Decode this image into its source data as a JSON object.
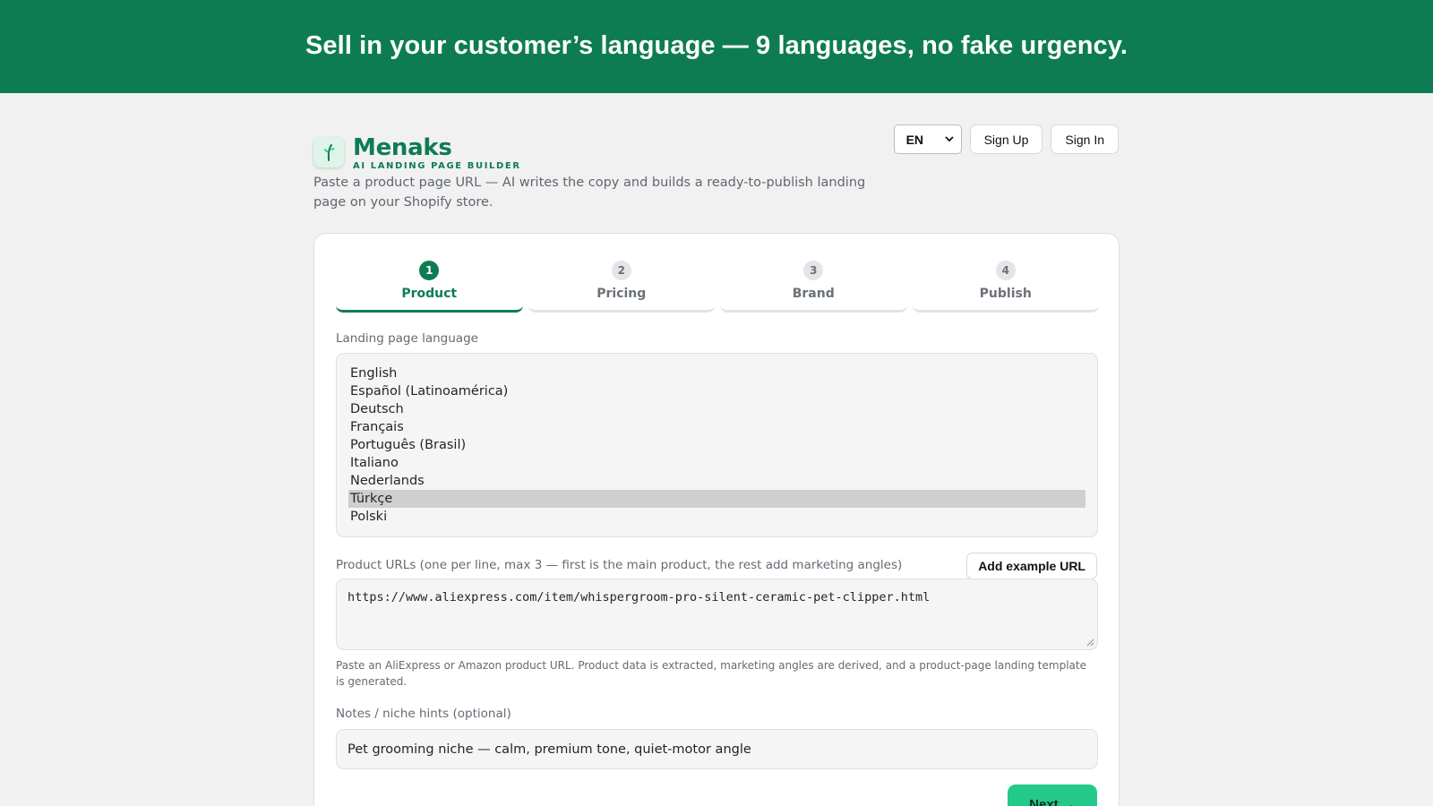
{
  "banner": {
    "text": "Sell in your customer’s language — 9 languages, no fake urgency."
  },
  "brand": {
    "name": "Menaks",
    "tagline": "AI LANDING PAGE BUILDER",
    "logo_icon": "sprout-icon",
    "description": "Paste a product page URL — AI writes the copy and builds a ready-to-publish landing page on your Shopify store."
  },
  "header": {
    "language_value": "EN",
    "sign_up_label": "Sign Up",
    "sign_in_label": "Sign In"
  },
  "steps": [
    {
      "num": "1",
      "label": "Product",
      "active": true
    },
    {
      "num": "2",
      "label": "Pricing",
      "active": false
    },
    {
      "num": "3",
      "label": "Brand",
      "active": false
    },
    {
      "num": "4",
      "label": "Publish",
      "active": false
    }
  ],
  "form": {
    "language_label": "Landing page language",
    "languages": [
      "English",
      "Español (Latinoamérica)",
      "Deutsch",
      "Français",
      "Português (Brasil)",
      "Italiano",
      "Nederlands",
      "Türkçe",
      "Polski"
    ],
    "selected_language": "Türkçe",
    "urls_label": "Product URLs (one per line, max 3 — first is the main product, the rest add marketing angles)",
    "add_example_label": "Add example URL",
    "urls_value": "https://www.aliexpress.com/item/whispergroom-pro-silent-ceramic-pet-clipper.html",
    "urls_hint": "Paste an AliExpress or Amazon product URL. Product data is extracted, marketing angles are derived, and a product-page landing template is generated.",
    "notes_label": "Notes / niche hints (optional)",
    "notes_value": "Pet grooming niche — calm, premium tone, quiet-motor angle",
    "next_label": "Next →"
  },
  "colors": {
    "brand_green": "#0e7c52",
    "accent_green": "#22c98a"
  }
}
